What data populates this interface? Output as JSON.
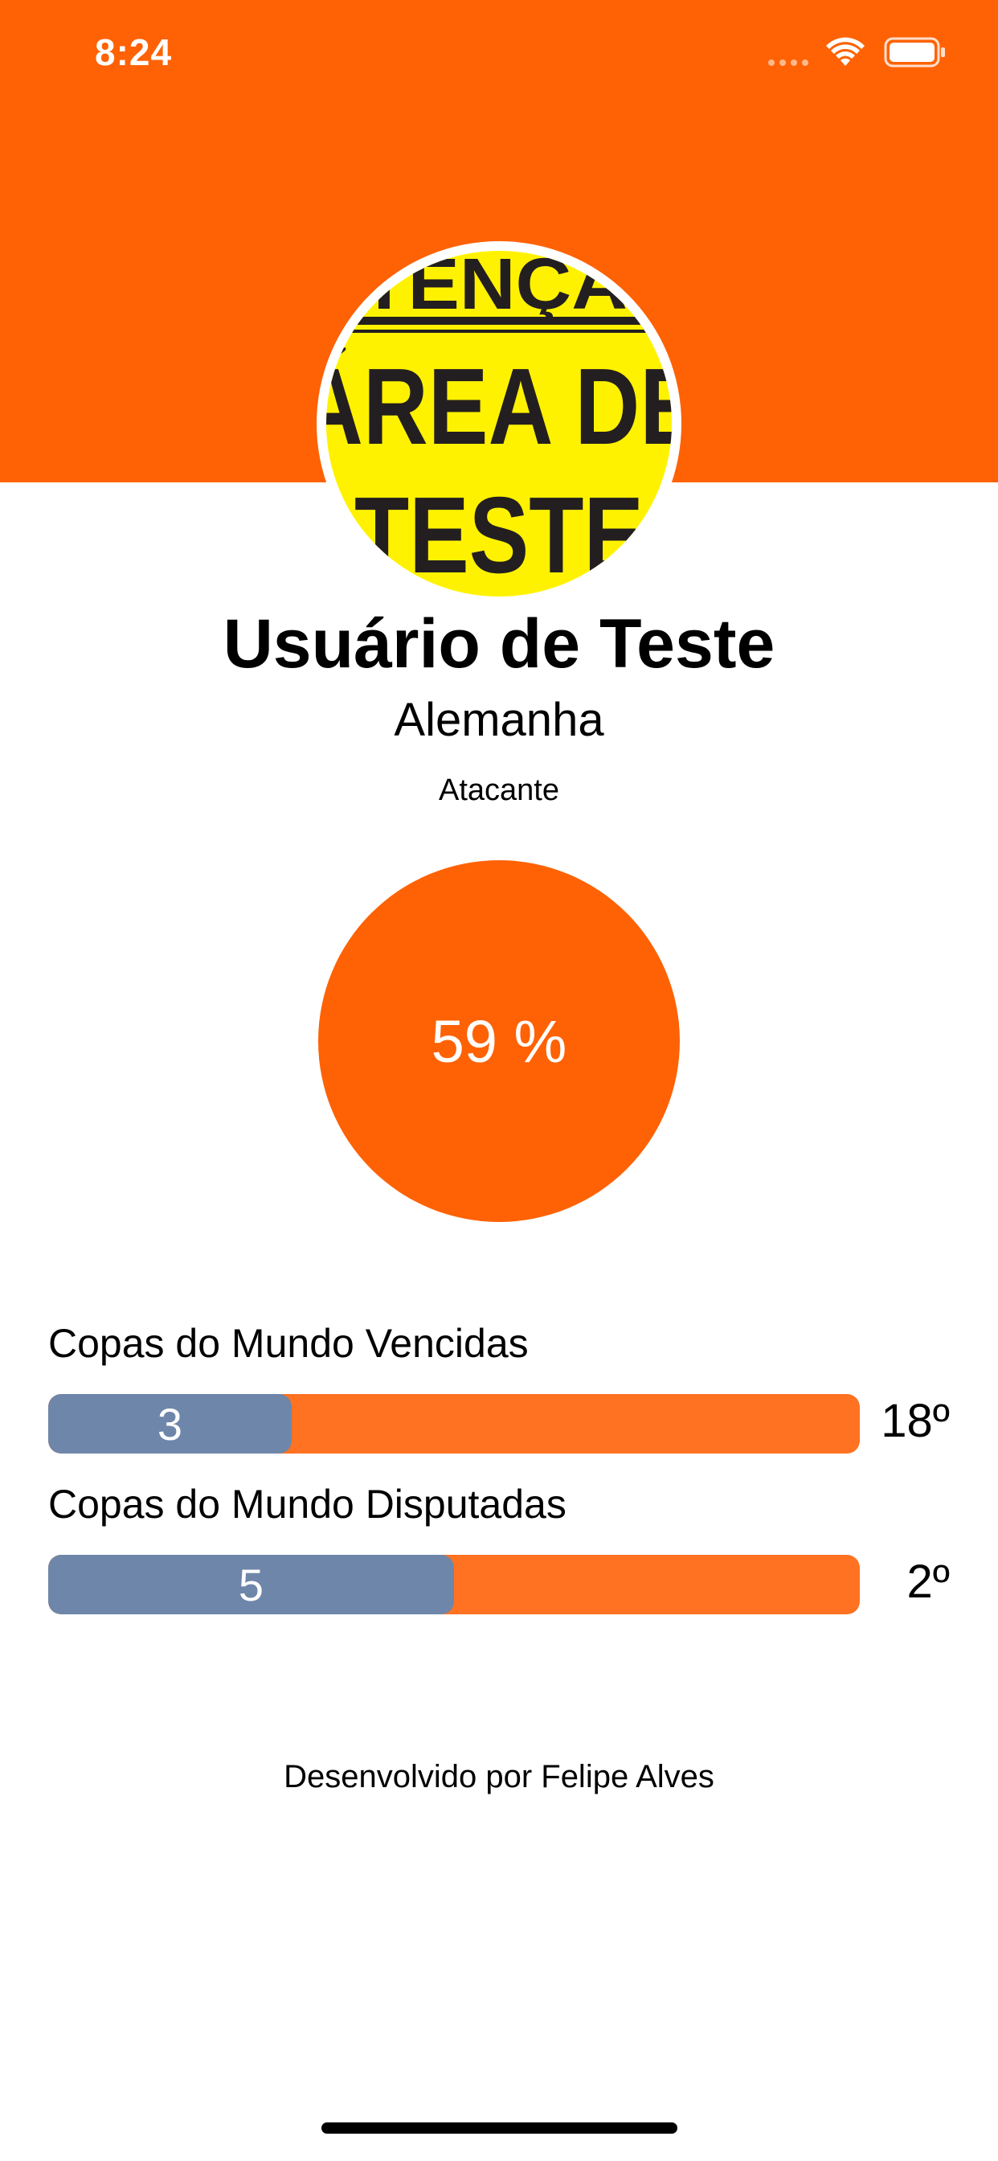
{
  "status_bar": {
    "time": "8:24"
  },
  "colors": {
    "accent": "#fe6205",
    "bar_track": "#fe7222",
    "bar_fill": "#6e86a9"
  },
  "avatar": {
    "icon": "avatar-test-area-sign",
    "line1": "ATENÇÃO",
    "line2": "ÁREA DE",
    "line3": "TESTE"
  },
  "profile": {
    "name": "Usuário de Teste",
    "country": "Alemanha",
    "position": "Atacante"
  },
  "score": {
    "percent_text": "59 %",
    "value": 59
  },
  "stats": [
    {
      "label": "Copas do Mundo Vencidas",
      "value": "3",
      "fill_fraction": 0.3,
      "rank": "18º"
    },
    {
      "label": "Copas do Mundo Disputadas",
      "value": "5",
      "fill_fraction": 0.5,
      "rank": "2º"
    }
  ],
  "footer": {
    "text": "Desenvolvido por Felipe Alves"
  }
}
